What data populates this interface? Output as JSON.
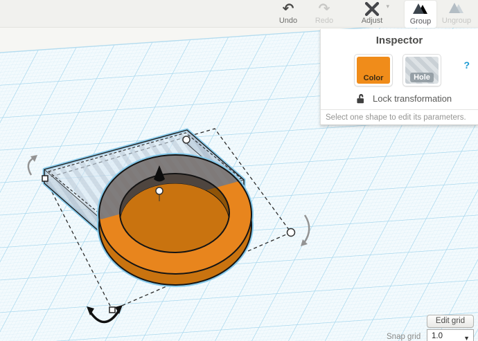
{
  "toolbar": {
    "undo_label": "Undo",
    "redo_label": "Redo",
    "adjust_label": "Adjust",
    "group_label": "Group",
    "ungroup_label": "Ungroup",
    "undo_glyph": "↶",
    "redo_glyph": "↷",
    "adjust_caret": "▾"
  },
  "inspector": {
    "title": "Inspector",
    "color_label": "Color",
    "hole_label": "Hole",
    "help_label": "?",
    "lock_label": "Lock transformation",
    "hint": "Select one shape to edit its parameters."
  },
  "grid_controls": {
    "edit_grid_label": "Edit grid",
    "snap_label": "Snap grid",
    "snap_value": "1.0",
    "dropdown_caret": "▼"
  },
  "scene_info": {
    "selected_shapes": 2,
    "shapes": [
      "orange ring (torus)",
      "translucent hole box"
    ],
    "colors": {
      "accent_orange": "#F08C1A",
      "ring_orange": "#E8851D",
      "ring_side_wall": "#C9730F",
      "ring_under_hole_box": "#635751",
      "selection_glow": "#86C9EA",
      "grid_major_line": "#A0D4EC",
      "grid_minor_line": "#D5ECF6",
      "workplane_base": "#F3FAFD",
      "sky": "#F6F6F3"
    }
  }
}
